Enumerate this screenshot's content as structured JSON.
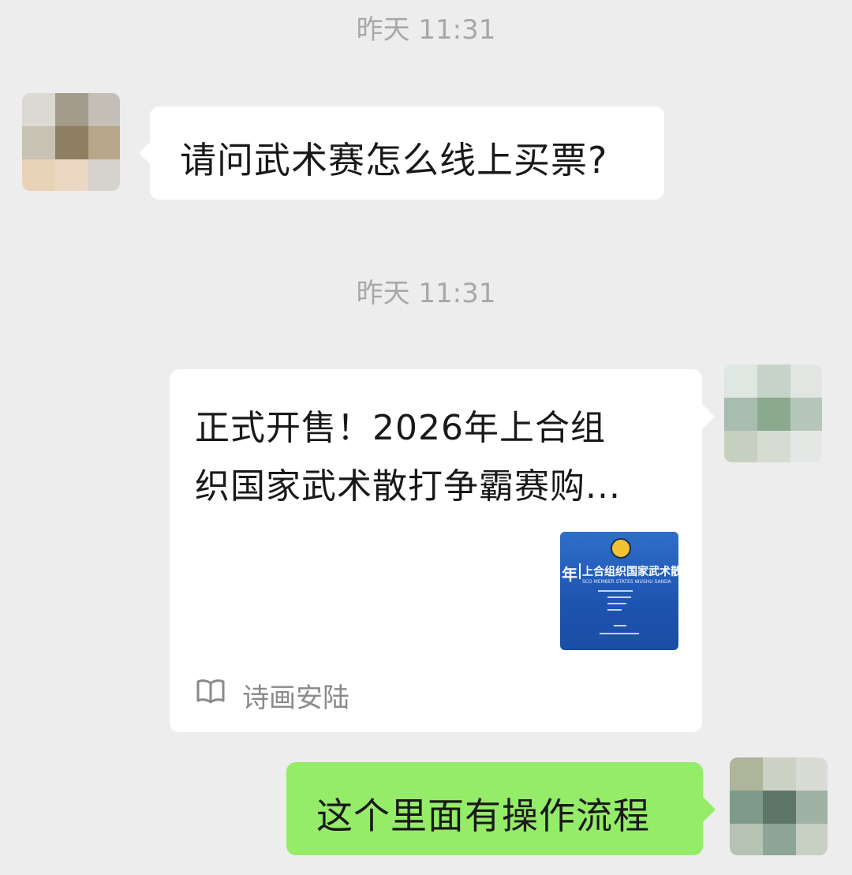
{
  "messages": [
    {
      "timestamp": "昨天 11:31",
      "text": "请问武术赛怎么线上买票?"
    },
    {
      "timestamp": "昨天 11:31",
      "card": {
        "title_line1": "正式开售！2026年上合组",
        "title_line2": "织国家武术散打争霸赛购...",
        "thumb_badge": "年",
        "thumb_title": "上合组织国家武术散",
        "thumb_subtitle": "SCO MEMBER STATES WUSHU SANDA",
        "source": "诗画安陆",
        "source_icon": "book-icon"
      }
    },
    {
      "text": "这个里面有操作流程"
    }
  ],
  "colors": {
    "background": "#ededed",
    "self_bubble": "#95ec69",
    "other_bubble": "#ffffff",
    "timestamp": "#a8a8a8"
  }
}
